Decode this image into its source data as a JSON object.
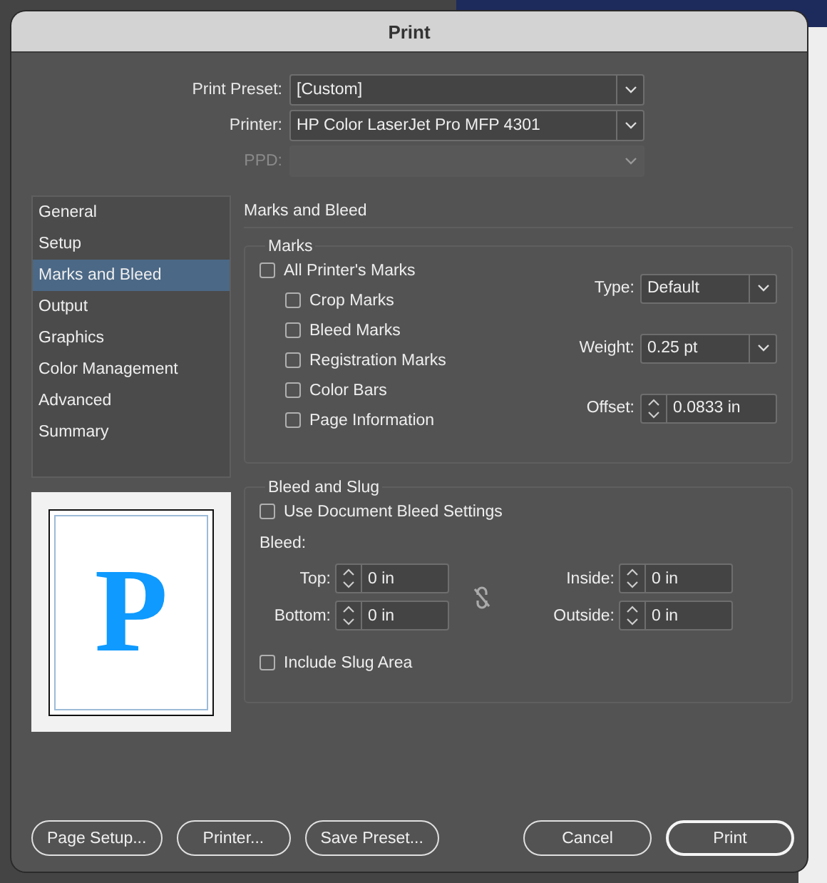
{
  "window": {
    "title": "Print"
  },
  "top_fields": [
    {
      "label": "Print Preset:",
      "value": "[Custom]",
      "disabled": false
    },
    {
      "label": "Printer:",
      "value": "HP Color LaserJet Pro MFP 4301",
      "disabled": false
    },
    {
      "label": "PPD:",
      "disabled": true
    }
  ],
  "sidebar": {
    "items": [
      {
        "label": "General",
        "selected": false
      },
      {
        "label": "Setup",
        "selected": false
      },
      {
        "label": "Marks and Bleed",
        "selected": true
      },
      {
        "label": "Output",
        "selected": false
      },
      {
        "label": "Graphics",
        "selected": false
      },
      {
        "label": "Color Management",
        "selected": false
      },
      {
        "label": "Advanced",
        "selected": false
      },
      {
        "label": "Summary",
        "selected": false
      }
    ]
  },
  "panel": {
    "title": "Marks and Bleed"
  },
  "marks": {
    "title": "Marks",
    "checkboxes": [
      {
        "label": "All Printer's Marks",
        "checked": false,
        "children": [
          {
            "label": "Crop Marks",
            "checked": false
          },
          {
            "label": "Bleed Marks",
            "checked": false
          },
          {
            "label": "Registration Marks",
            "checked": false
          },
          {
            "label": "Color Bars",
            "checked": false
          },
          {
            "label": "Page Information",
            "checked": false
          }
        ]
      }
    ],
    "settings": [
      {
        "kind": "dropdown",
        "label": "Type:",
        "value": "Default"
      },
      {
        "kind": "dropdown",
        "label": "Weight:",
        "value": "0.25 pt"
      },
      {
        "kind": "stepper",
        "label": "Offset:",
        "value": "0.0833 in"
      }
    ]
  },
  "preview": {
    "letter": "P"
  },
  "bleed": {
    "title": "Bleed and Slug",
    "use_document": {
      "label": "Use Document Bleed Settings",
      "checked": false
    },
    "bleed_label": "Bleed:",
    "fields": [
      {
        "label": "Top:",
        "value": "0 in"
      },
      {
        "label": "Inside:",
        "value": "0 in"
      },
      {
        "label": "Bottom:",
        "value": "0 in"
      },
      {
        "label": "Outside:",
        "value": "0 in"
      }
    ],
    "linked": false,
    "slug": {
      "label": "Include Slug Area",
      "checked": false
    }
  },
  "buttons_left": [
    {
      "label": "Page Setup...",
      "default": false
    },
    {
      "label": "Printer...",
      "default": false
    },
    {
      "label": "Save Preset...",
      "default": false
    }
  ],
  "buttons_right": [
    {
      "label": "Cancel",
      "default": false
    },
    {
      "label": "Print",
      "default": true
    }
  ]
}
